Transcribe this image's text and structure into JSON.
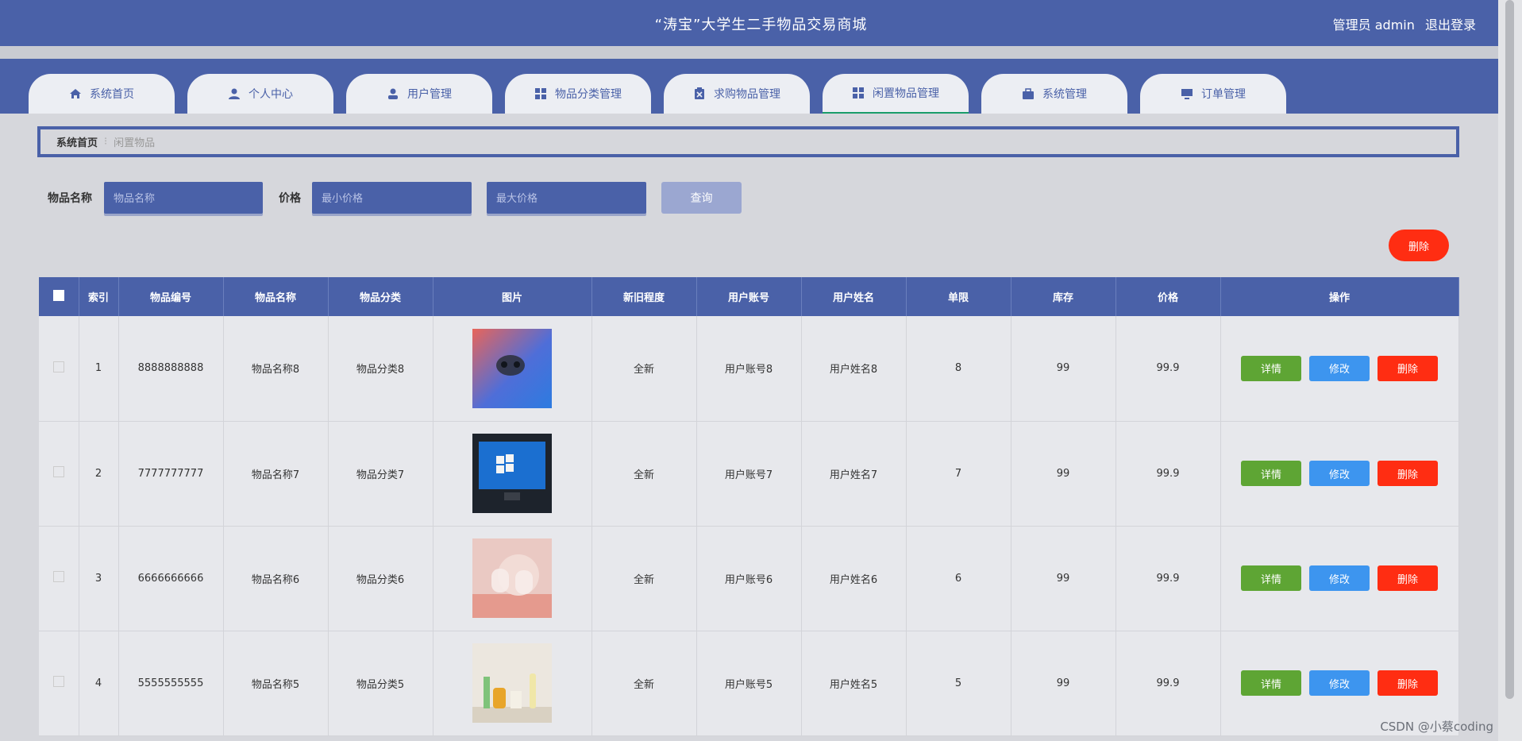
{
  "header": {
    "title": "“涛宝”大学生二手物品交易商城",
    "admin_label": "管理员 admin",
    "logout_label": "退出登录"
  },
  "nav": {
    "tabs": [
      {
        "label": "系统首页",
        "icon": "home-icon"
      },
      {
        "label": "个人中心",
        "icon": "user-icon"
      },
      {
        "label": "用户管理",
        "icon": "user-manage-icon"
      },
      {
        "label": "物品分类管理",
        "icon": "grid-icon"
      },
      {
        "label": "求购物品管理",
        "icon": "clipboard-icon"
      },
      {
        "label": "闲置物品管理",
        "icon": "grid-icon",
        "active": true
      },
      {
        "label": "系统管理",
        "icon": "briefcase-icon"
      },
      {
        "label": "订单管理",
        "icon": "monitor-icon"
      }
    ]
  },
  "breadcrumb": {
    "home": "系统首页",
    "current": "闲置物品"
  },
  "search": {
    "name_label": "物品名称",
    "name_placeholder": "物品名称",
    "price_label": "价格",
    "min_placeholder": "最小价格",
    "max_placeholder": "最大价格",
    "query_button": "查询"
  },
  "delete_button": "删除",
  "table": {
    "headers": [
      "索引",
      "物品编号",
      "物品名称",
      "物品分类",
      "图片",
      "新旧程度",
      "用户账号",
      "用户姓名",
      "单限",
      "库存",
      "价格",
      "操作"
    ],
    "rows": [
      {
        "index": "1",
        "code": "8888888888",
        "name": "物品名称8",
        "category": "物品分类8",
        "condition": "全新",
        "account": "用户账号8",
        "username": "用户姓名8",
        "limit": "8",
        "stock": "99",
        "price": "99.9"
      },
      {
        "index": "2",
        "code": "7777777777",
        "name": "物品名称7",
        "category": "物品分类7",
        "condition": "全新",
        "account": "用户账号7",
        "username": "用户姓名7",
        "limit": "7",
        "stock": "99",
        "price": "99.9"
      },
      {
        "index": "3",
        "code": "6666666666",
        "name": "物品名称6",
        "category": "物品分类6",
        "condition": "全新",
        "account": "用户账号6",
        "username": "用户姓名6",
        "limit": "6",
        "stock": "99",
        "price": "99.9"
      },
      {
        "index": "4",
        "code": "5555555555",
        "name": "物品名称5",
        "category": "物品分类5",
        "condition": "全新",
        "account": "用户账号5",
        "username": "用户姓名5",
        "limit": "5",
        "stock": "99",
        "price": "99.9"
      }
    ],
    "ops": {
      "detail": "详情",
      "edit": "修改",
      "delete": "删除"
    }
  },
  "watermark": "CSDN @小蔡coding",
  "colors": {
    "primary": "#4a61a8",
    "danger": "#ff2d12",
    "success": "#5ea534",
    "info": "#3d95ef"
  }
}
